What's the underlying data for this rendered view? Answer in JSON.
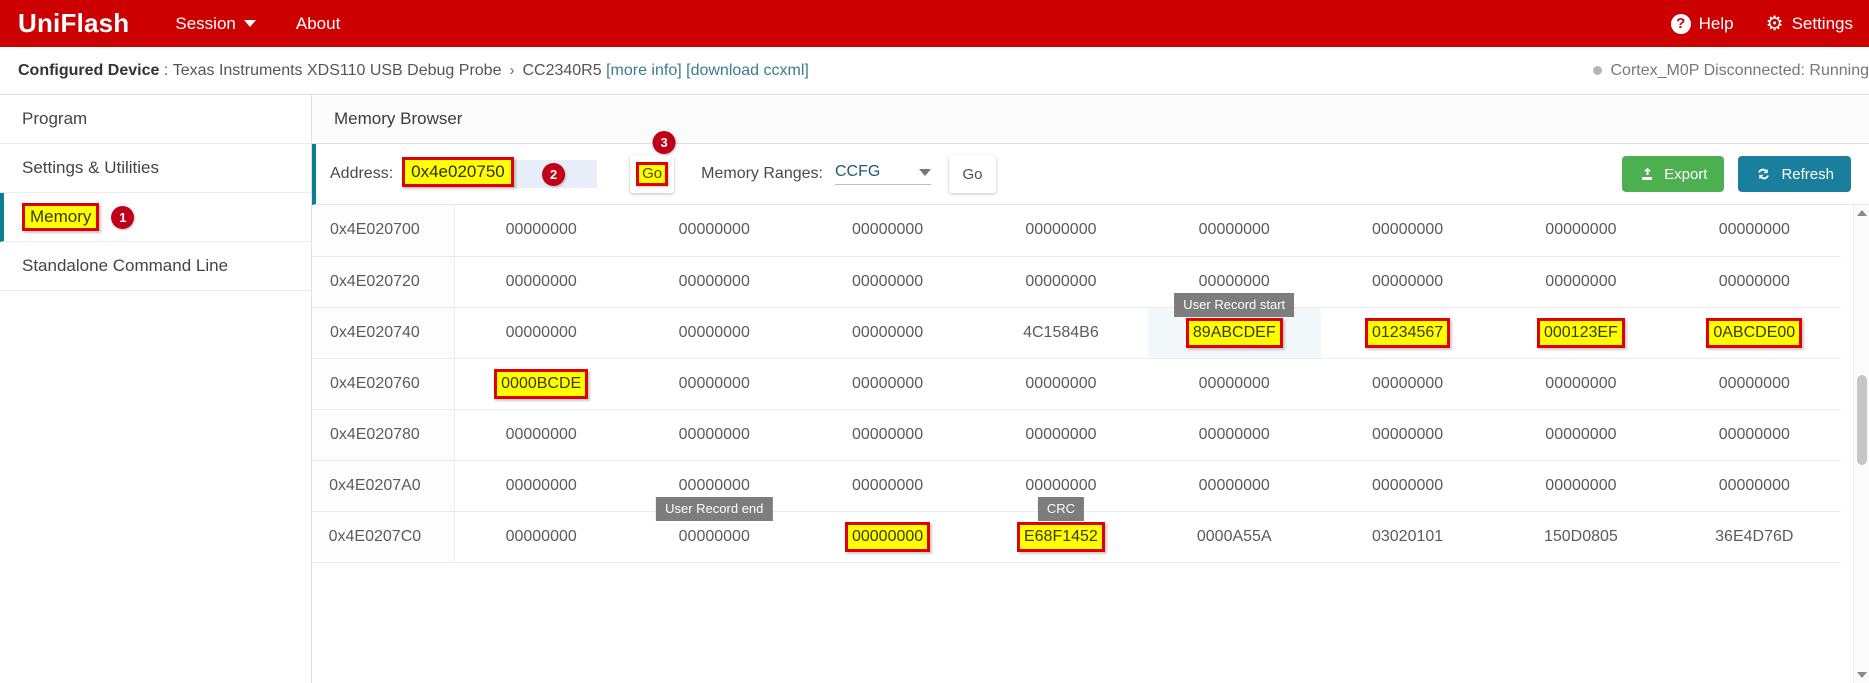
{
  "topbar": {
    "brand": "UniFlash",
    "session_label": "Session",
    "about_label": "About",
    "help_label": "Help",
    "help_icon_glyph": "?",
    "settings_label": "Settings",
    "settings_icon": "gear-icon",
    "bg_color": "#cc0000"
  },
  "device_bar": {
    "prefix_label": "Configured Device",
    "separator": ":",
    "probe": "Texas Instruments XDS110 USB Debug Probe",
    "chevron": "›",
    "device": "CC2340R5",
    "more_info_link": "[more info]",
    "download_link": "[download ccxml]",
    "status": "Cortex_M0P Disconnected: Running"
  },
  "sidebar": {
    "items": [
      {
        "label": "Program",
        "active": false,
        "badge": null
      },
      {
        "label": "Settings & Utilities",
        "active": false,
        "badge": null
      },
      {
        "label": "Memory",
        "active": true,
        "highlighted": true,
        "badge": "1"
      },
      {
        "label": "Standalone Command Line",
        "active": false,
        "badge": null
      }
    ]
  },
  "main": {
    "header_title": "Memory Browser"
  },
  "toolbar": {
    "address_label": "Address:",
    "address_value": "0x4e020750",
    "address_badge": "2",
    "go_label": "Go",
    "go_badge": "3",
    "ranges_label": "Memory Ranges:",
    "ranges_selected": "CCFG",
    "ranges_go_label": "Go",
    "export_label": "Export",
    "export_color": "#4caf50",
    "refresh_label": "Refresh",
    "refresh_color": "#1a7f9c"
  },
  "memory_table": {
    "rows": [
      {
        "address": "0x4E020700",
        "cells": [
          {
            "value": "00000000"
          },
          {
            "value": "00000000"
          },
          {
            "value": "00000000"
          },
          {
            "value": "00000000"
          },
          {
            "value": "00000000"
          },
          {
            "value": "00000000"
          },
          {
            "value": "00000000"
          },
          {
            "value": "00000000"
          }
        ]
      },
      {
        "address": "0x4E020720",
        "cells": [
          {
            "value": "00000000"
          },
          {
            "value": "00000000"
          },
          {
            "value": "00000000"
          },
          {
            "value": "00000000"
          },
          {
            "value": "00000000"
          },
          {
            "value": "00000000"
          },
          {
            "value": "00000000"
          },
          {
            "value": "00000000"
          }
        ]
      },
      {
        "address": "0x4E020740",
        "cells": [
          {
            "value": "00000000"
          },
          {
            "value": "00000000"
          },
          {
            "value": "00000000"
          },
          {
            "value": "4C1584B6"
          },
          {
            "value": "89ABCDEF",
            "highlight": true,
            "tinted": true,
            "tooltip": "User Record start"
          },
          {
            "value": "01234567",
            "highlight": true
          },
          {
            "value": "000123EF",
            "highlight": true
          },
          {
            "value": "0ABCDE00",
            "highlight": true
          }
        ]
      },
      {
        "address": "0x4E020760",
        "cells": [
          {
            "value": "0000BCDE",
            "highlight": true
          },
          {
            "value": "00000000"
          },
          {
            "value": "00000000"
          },
          {
            "value": "00000000"
          },
          {
            "value": "00000000"
          },
          {
            "value": "00000000"
          },
          {
            "value": "00000000"
          },
          {
            "value": "00000000"
          }
        ]
      },
      {
        "address": "0x4E020780",
        "cells": [
          {
            "value": "00000000"
          },
          {
            "value": "00000000"
          },
          {
            "value": "00000000"
          },
          {
            "value": "00000000"
          },
          {
            "value": "00000000"
          },
          {
            "value": "00000000"
          },
          {
            "value": "00000000"
          },
          {
            "value": "00000000"
          }
        ]
      },
      {
        "address": "0x4E0207A0",
        "cells": [
          {
            "value": "00000000"
          },
          {
            "value": "00000000"
          },
          {
            "value": "00000000"
          },
          {
            "value": "00000000"
          },
          {
            "value": "00000000"
          },
          {
            "value": "00000000"
          },
          {
            "value": "00000000"
          },
          {
            "value": "00000000"
          }
        ]
      },
      {
        "address": "0x4E0207C0",
        "cells": [
          {
            "value": "00000000"
          },
          {
            "value": "00000000",
            "tooltip": "User Record end"
          },
          {
            "value": "00000000",
            "highlight": true
          },
          {
            "value": "E68F1452",
            "highlight": true,
            "tooltip": "CRC"
          },
          {
            "value": "0000A55A"
          },
          {
            "value": "03020101"
          },
          {
            "value": "150D0805"
          },
          {
            "value": "36E4D76D"
          }
        ]
      }
    ]
  }
}
